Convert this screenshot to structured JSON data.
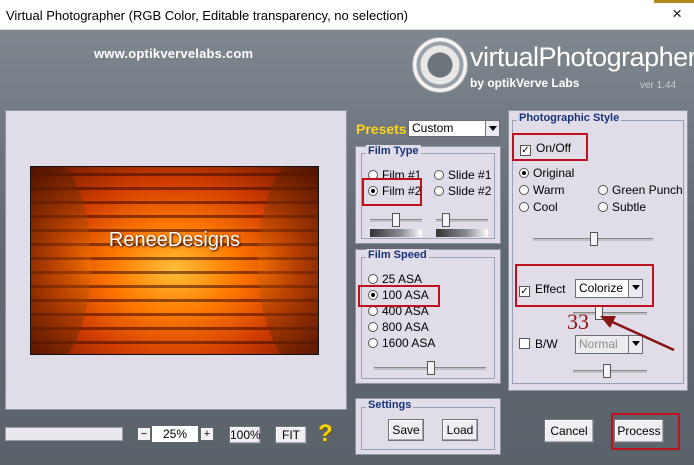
{
  "window": {
    "title": "Virtual Photographer (RGB Color, Editable transparency, no selection)",
    "close_icon": "×"
  },
  "banner": {
    "url": "www.optikvervelabs.com",
    "logo_name": "virtualPhotographer",
    "logo_by": "by optikVerve Labs",
    "version": "ver 1.44"
  },
  "preview": {
    "caption": "ReneeDesigns"
  },
  "zoom": {
    "minus": "−",
    "value": "25%",
    "plus": "+",
    "btn_100": "100%",
    "btn_fit": "FIT",
    "help": "?"
  },
  "presets": {
    "label": "Presets",
    "value": "Custom"
  },
  "film_type": {
    "title": "Film Type",
    "options": [
      "Film #1",
      "Slide #1",
      "Film #2",
      "Slide #2"
    ],
    "selected": "Film #2"
  },
  "film_speed": {
    "title": "Film Speed",
    "options": [
      "25 ASA",
      "100 ASA",
      "400 ASA",
      "800 ASA",
      "1600 ASA"
    ],
    "selected": "100 ASA"
  },
  "settings": {
    "title": "Settings",
    "save": "Save",
    "load": "Load"
  },
  "photographic_style": {
    "title": "Photographic Style",
    "on_off": "On/Off",
    "on_off_checked": true,
    "tones": [
      "Original",
      "Warm",
      "Green Punch",
      "Cool",
      "Subtle"
    ],
    "tone_selected": "Original",
    "effect_label": "Effect",
    "effect_checked": true,
    "effect_value": "Colorize",
    "bw_label": "B/W",
    "bw_checked": false,
    "bw_value": "Normal"
  },
  "annotation": {
    "number": "33"
  },
  "actions": {
    "cancel": "Cancel",
    "process": "Process"
  },
  "colors": {
    "annotation_red": "#c0101f",
    "group_title": "#17337a",
    "presets_label": "#ffd21d"
  }
}
